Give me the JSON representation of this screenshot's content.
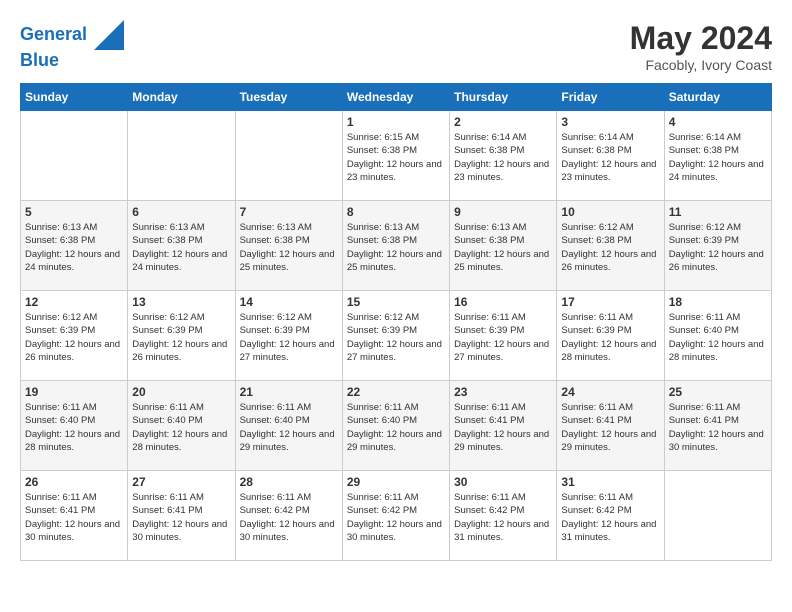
{
  "logo": {
    "line1": "General",
    "line2": "Blue"
  },
  "title": "May 2024",
  "location": "Facobly, Ivory Coast",
  "days_header": [
    "Sunday",
    "Monday",
    "Tuesday",
    "Wednesday",
    "Thursday",
    "Friday",
    "Saturday"
  ],
  "weeks": [
    [
      {
        "day": "",
        "sunrise": "",
        "sunset": "",
        "daylight": ""
      },
      {
        "day": "",
        "sunrise": "",
        "sunset": "",
        "daylight": ""
      },
      {
        "day": "",
        "sunrise": "",
        "sunset": "",
        "daylight": ""
      },
      {
        "day": "1",
        "sunrise": "Sunrise: 6:15 AM",
        "sunset": "Sunset: 6:38 PM",
        "daylight": "Daylight: 12 hours and 23 minutes."
      },
      {
        "day": "2",
        "sunrise": "Sunrise: 6:14 AM",
        "sunset": "Sunset: 6:38 PM",
        "daylight": "Daylight: 12 hours and 23 minutes."
      },
      {
        "day": "3",
        "sunrise": "Sunrise: 6:14 AM",
        "sunset": "Sunset: 6:38 PM",
        "daylight": "Daylight: 12 hours and 23 minutes."
      },
      {
        "day": "4",
        "sunrise": "Sunrise: 6:14 AM",
        "sunset": "Sunset: 6:38 PM",
        "daylight": "Daylight: 12 hours and 24 minutes."
      }
    ],
    [
      {
        "day": "5",
        "sunrise": "Sunrise: 6:13 AM",
        "sunset": "Sunset: 6:38 PM",
        "daylight": "Daylight: 12 hours and 24 minutes."
      },
      {
        "day": "6",
        "sunrise": "Sunrise: 6:13 AM",
        "sunset": "Sunset: 6:38 PM",
        "daylight": "Daylight: 12 hours and 24 minutes."
      },
      {
        "day": "7",
        "sunrise": "Sunrise: 6:13 AM",
        "sunset": "Sunset: 6:38 PM",
        "daylight": "Daylight: 12 hours and 25 minutes."
      },
      {
        "day": "8",
        "sunrise": "Sunrise: 6:13 AM",
        "sunset": "Sunset: 6:38 PM",
        "daylight": "Daylight: 12 hours and 25 minutes."
      },
      {
        "day": "9",
        "sunrise": "Sunrise: 6:13 AM",
        "sunset": "Sunset: 6:38 PM",
        "daylight": "Daylight: 12 hours and 25 minutes."
      },
      {
        "day": "10",
        "sunrise": "Sunrise: 6:12 AM",
        "sunset": "Sunset: 6:38 PM",
        "daylight": "Daylight: 12 hours and 26 minutes."
      },
      {
        "day": "11",
        "sunrise": "Sunrise: 6:12 AM",
        "sunset": "Sunset: 6:39 PM",
        "daylight": "Daylight: 12 hours and 26 minutes."
      }
    ],
    [
      {
        "day": "12",
        "sunrise": "Sunrise: 6:12 AM",
        "sunset": "Sunset: 6:39 PM",
        "daylight": "Daylight: 12 hours and 26 minutes."
      },
      {
        "day": "13",
        "sunrise": "Sunrise: 6:12 AM",
        "sunset": "Sunset: 6:39 PM",
        "daylight": "Daylight: 12 hours and 26 minutes."
      },
      {
        "day": "14",
        "sunrise": "Sunrise: 6:12 AM",
        "sunset": "Sunset: 6:39 PM",
        "daylight": "Daylight: 12 hours and 27 minutes."
      },
      {
        "day": "15",
        "sunrise": "Sunrise: 6:12 AM",
        "sunset": "Sunset: 6:39 PM",
        "daylight": "Daylight: 12 hours and 27 minutes."
      },
      {
        "day": "16",
        "sunrise": "Sunrise: 6:11 AM",
        "sunset": "Sunset: 6:39 PM",
        "daylight": "Daylight: 12 hours and 27 minutes."
      },
      {
        "day": "17",
        "sunrise": "Sunrise: 6:11 AM",
        "sunset": "Sunset: 6:39 PM",
        "daylight": "Daylight: 12 hours and 28 minutes."
      },
      {
        "day": "18",
        "sunrise": "Sunrise: 6:11 AM",
        "sunset": "Sunset: 6:40 PM",
        "daylight": "Daylight: 12 hours and 28 minutes."
      }
    ],
    [
      {
        "day": "19",
        "sunrise": "Sunrise: 6:11 AM",
        "sunset": "Sunset: 6:40 PM",
        "daylight": "Daylight: 12 hours and 28 minutes."
      },
      {
        "day": "20",
        "sunrise": "Sunrise: 6:11 AM",
        "sunset": "Sunset: 6:40 PM",
        "daylight": "Daylight: 12 hours and 28 minutes."
      },
      {
        "day": "21",
        "sunrise": "Sunrise: 6:11 AM",
        "sunset": "Sunset: 6:40 PM",
        "daylight": "Daylight: 12 hours and 29 minutes."
      },
      {
        "day": "22",
        "sunrise": "Sunrise: 6:11 AM",
        "sunset": "Sunset: 6:40 PM",
        "daylight": "Daylight: 12 hours and 29 minutes."
      },
      {
        "day": "23",
        "sunrise": "Sunrise: 6:11 AM",
        "sunset": "Sunset: 6:41 PM",
        "daylight": "Daylight: 12 hours and 29 minutes."
      },
      {
        "day": "24",
        "sunrise": "Sunrise: 6:11 AM",
        "sunset": "Sunset: 6:41 PM",
        "daylight": "Daylight: 12 hours and 29 minutes."
      },
      {
        "day": "25",
        "sunrise": "Sunrise: 6:11 AM",
        "sunset": "Sunset: 6:41 PM",
        "daylight": "Daylight: 12 hours and 30 minutes."
      }
    ],
    [
      {
        "day": "26",
        "sunrise": "Sunrise: 6:11 AM",
        "sunset": "Sunset: 6:41 PM",
        "daylight": "Daylight: 12 hours and 30 minutes."
      },
      {
        "day": "27",
        "sunrise": "Sunrise: 6:11 AM",
        "sunset": "Sunset: 6:41 PM",
        "daylight": "Daylight: 12 hours and 30 minutes."
      },
      {
        "day": "28",
        "sunrise": "Sunrise: 6:11 AM",
        "sunset": "Sunset: 6:42 PM",
        "daylight": "Daylight: 12 hours and 30 minutes."
      },
      {
        "day": "29",
        "sunrise": "Sunrise: 6:11 AM",
        "sunset": "Sunset: 6:42 PM",
        "daylight": "Daylight: 12 hours and 30 minutes."
      },
      {
        "day": "30",
        "sunrise": "Sunrise: 6:11 AM",
        "sunset": "Sunset: 6:42 PM",
        "daylight": "Daylight: 12 hours and 31 minutes."
      },
      {
        "day": "31",
        "sunrise": "Sunrise: 6:11 AM",
        "sunset": "Sunset: 6:42 PM",
        "daylight": "Daylight: 12 hours and 31 minutes."
      },
      {
        "day": "",
        "sunrise": "",
        "sunset": "",
        "daylight": ""
      }
    ]
  ]
}
